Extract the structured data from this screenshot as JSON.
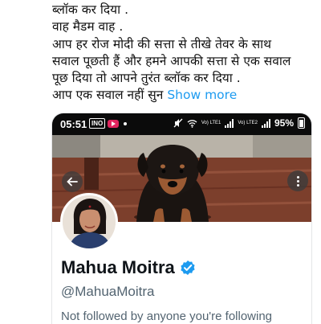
{
  "tweet": {
    "lines": [
      "ब्लॉक कर दिया .",
      "वाह मैडम वाह .",
      "आप हर रोज मोदी की सत्ता से तीखे तेवर के साथ",
      "सवाल पूछती हैं और हमने आपकी सत्ता से एक सवाल",
      "पूछ दिया तो आपने तुरंत ब्लॉक कर दिया .",
      "आप एक सवाल नहीं सुन"
    ],
    "show_more": "Show more"
  },
  "screenshot": {
    "status_bar": {
      "time": "05:51",
      "net_badge": "INO",
      "volte1": "Vo) LTE1",
      "volte2": "Vo) LTE2",
      "battery": "95%"
    },
    "profile": {
      "name": "Mahua Moitra",
      "handle": "@MahuaMoitra",
      "followed_note": "Not followed by anyone you're following"
    }
  },
  "colors": {
    "link": "#1d9bf0",
    "verified": "#1d9bf0",
    "secondary_text": "#536471",
    "status_bar": "#0b0b0b"
  },
  "icons": {
    "back": "arrow-left-icon",
    "more": "more-vertical-icon",
    "verified": "verified-badge-icon"
  }
}
